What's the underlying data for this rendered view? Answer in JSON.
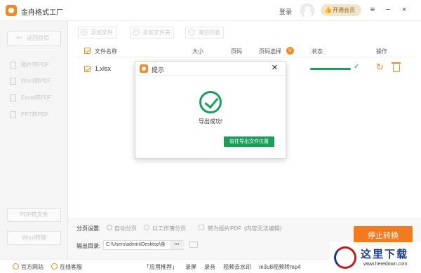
{
  "app": {
    "title": "金舟格式工厂"
  },
  "header": {
    "login_label": "登录",
    "vip_label": "开通会员",
    "vip_icon": "thumb-up-icon"
  },
  "window_controls": {
    "menu": "≡",
    "minimize": "−",
    "close": "×"
  },
  "sidebar": {
    "back_label": "返回首页",
    "items": [
      {
        "label": "图片转PDF",
        "icon": "image-icon"
      },
      {
        "label": "Word转PDF",
        "icon": "word-icon"
      },
      {
        "label": "Excel转PDF",
        "icon": "excel-icon"
      },
      {
        "label": "PPT转PDF",
        "icon": "ppt-icon"
      }
    ],
    "bottom_buttons": [
      "PDF转文件",
      "Word转换"
    ]
  },
  "toolbar": {
    "add_file": "添加文件",
    "add_folder": "添加文件夹",
    "clear_list": "清空列表"
  },
  "table": {
    "headers": {
      "file_name": "文件名称",
      "size": "大小",
      "pages": "页码",
      "page_select": "页码选择",
      "status": "状态",
      "actions": "操作"
    },
    "page_select_badge": "V",
    "rows": [
      {
        "file_name": "1.xlsx",
        "progress": 1.0
      }
    ]
  },
  "bottom": {
    "pagination_label": "分页设置:",
    "auto_paging": "自动分页",
    "sheet_paging": "以工作簿分页",
    "to_image_pdf": "转为图片PDF",
    "to_image_pdf_note": "(内容无法编辑)",
    "output_label": "输出目录:",
    "output_path": "C:\\Users\\admin\\Desktop\\金",
    "browse_label": "•••",
    "stop_button": "停止转换"
  },
  "status_bar": {
    "website": "官方网站",
    "service": "在线客服",
    "recommend": "「应用推荐」",
    "screen_record": "录屏",
    "audio_record": "录音",
    "remove_watermark": "视频去水印",
    "m3u8": "m3u8视频转mp4"
  },
  "dialog": {
    "title": "提示",
    "close": "×",
    "message": "导出成功!",
    "button": "前往导出文件位置"
  },
  "watermark": {
    "title": "这里下载",
    "url": "www.heredown.com"
  },
  "colors": {
    "accent": "#f08a24",
    "success": "#18a058",
    "stop_button": "#f27a1f"
  }
}
